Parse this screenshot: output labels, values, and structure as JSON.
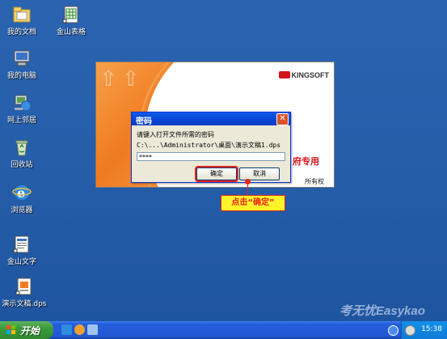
{
  "desktop": {
    "icons": [
      {
        "label": "我的文档"
      },
      {
        "label": "金山表格"
      },
      {
        "label": "我的电脑"
      },
      {
        "label": "网上邻居"
      },
      {
        "label": "回收站"
      },
      {
        "label": "浏览器"
      },
      {
        "label": "金山文字"
      },
      {
        "label": "演示文稿.dps"
      }
    ]
  },
  "splash": {
    "brand": "KINGSOFT",
    "tagline": "府专用",
    "rights": "所有权利。"
  },
  "dialog": {
    "title": "密码",
    "prompt": "请键入打开文件所需的密码",
    "path": "C:\\...\\Administrator\\桌面\\演示文稿1.dps",
    "password_value": "****",
    "ok_label": "确定",
    "cancel_label": "取消",
    "close_glyph": "✕"
  },
  "annotation": {
    "callout": "点击“确定”"
  },
  "watermark": "考无忧Easykao",
  "taskbar": {
    "start_label": "开始",
    "clock": "15:38"
  },
  "colors": {
    "desktop": "#245DA8",
    "accent_red": "#E8241C",
    "callout_yellow": "#FFF32A"
  }
}
